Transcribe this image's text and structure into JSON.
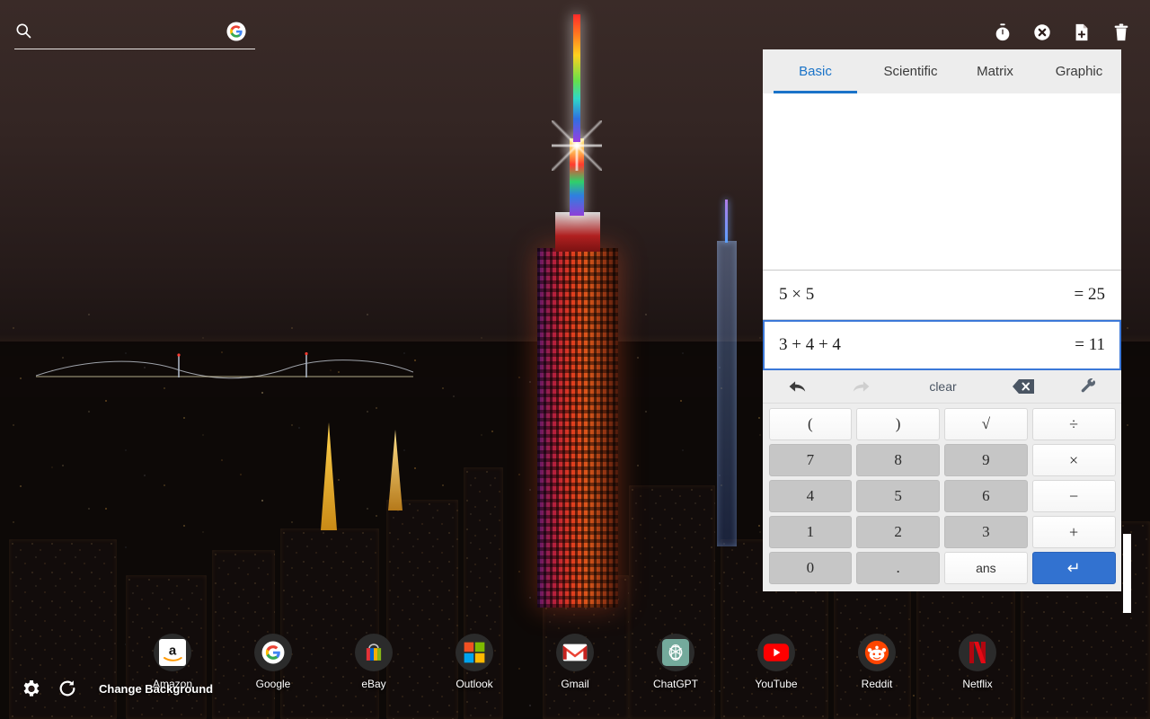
{
  "topbar": {
    "search_placeholder": "",
    "search_value": "",
    "search_icon": "search-icon",
    "google_icon": "google-g-icon",
    "actions": [
      {
        "name": "timer-icon",
        "label": "Timer"
      },
      {
        "name": "close-circle-icon",
        "label": "Close"
      },
      {
        "name": "new-note-icon",
        "label": "New note"
      },
      {
        "name": "trash-icon",
        "label": "Delete"
      }
    ]
  },
  "calculator": {
    "tabs": [
      {
        "label": "Basic",
        "active": true
      },
      {
        "label": "Scientific",
        "active": false
      },
      {
        "label": "Matrix",
        "active": false
      },
      {
        "label": "Graphic",
        "active": false
      }
    ],
    "accent_color": "#1a73c8",
    "display_value": "",
    "history": [
      {
        "expression": "5 × 5",
        "result": "= 25",
        "selected": false
      },
      {
        "expression": "3 + 4 + 4",
        "result": "= 11",
        "selected": true
      }
    ],
    "toolbar": {
      "undo_icon": "undo-icon",
      "redo_icon": "redo-icon",
      "clear_label": "clear",
      "backspace_icon": "backspace-icon",
      "settings_icon": "wrench-icon"
    },
    "keypad": [
      [
        {
          "label": "(",
          "type": "fn"
        },
        {
          "label": ")",
          "type": "fn"
        },
        {
          "label": "√",
          "type": "fn"
        },
        {
          "label": "÷",
          "type": "op"
        }
      ],
      [
        {
          "label": "7",
          "type": "num"
        },
        {
          "label": "8",
          "type": "num"
        },
        {
          "label": "9",
          "type": "num"
        },
        {
          "label": "×",
          "type": "op"
        }
      ],
      [
        {
          "label": "4",
          "type": "num"
        },
        {
          "label": "5",
          "type": "num"
        },
        {
          "label": "6",
          "type": "num"
        },
        {
          "label": "−",
          "type": "op"
        }
      ],
      [
        {
          "label": "1",
          "type": "num"
        },
        {
          "label": "2",
          "type": "num"
        },
        {
          "label": "3",
          "type": "num"
        },
        {
          "label": "+",
          "type": "op"
        }
      ],
      [
        {
          "label": "0",
          "type": "num"
        },
        {
          "label": ".",
          "type": "num"
        },
        {
          "label": "ans",
          "type": "ans"
        },
        {
          "label": "↵",
          "type": "enter"
        }
      ]
    ]
  },
  "dock": {
    "items": [
      {
        "label": "Amazon",
        "icon": "amazon-icon"
      },
      {
        "label": "Google",
        "icon": "google-icon"
      },
      {
        "label": "eBay",
        "icon": "ebay-icon"
      },
      {
        "label": "Outlook",
        "icon": "outlook-icon"
      },
      {
        "label": "Gmail",
        "icon": "gmail-icon"
      },
      {
        "label": "ChatGPT",
        "icon": "chatgpt-icon"
      },
      {
        "label": "YouTube",
        "icon": "youtube-icon"
      },
      {
        "label": "Reddit",
        "icon": "reddit-icon"
      },
      {
        "label": "Netflix",
        "icon": "netflix-icon"
      }
    ]
  },
  "desktop_controls": {
    "settings_icon": "gear-icon",
    "refresh_icon": "refresh-icon",
    "change_background_label": "Change Background"
  }
}
